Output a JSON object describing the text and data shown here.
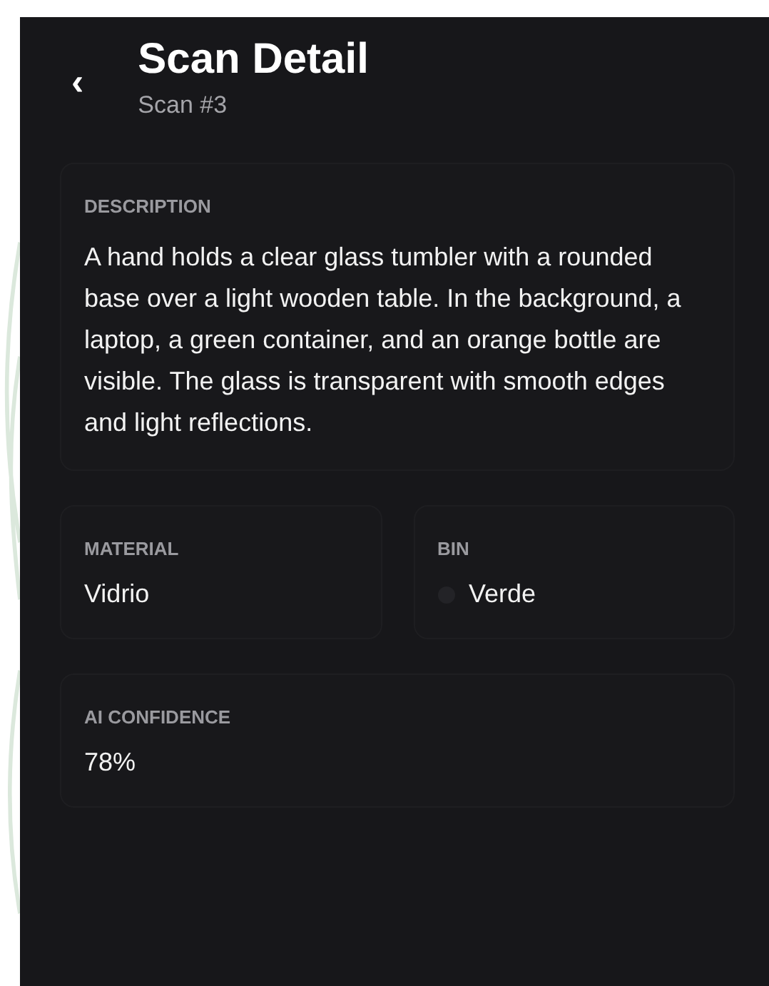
{
  "header": {
    "back": "‹",
    "title": "Scan Detail",
    "subtitle": "Scan #3"
  },
  "description": {
    "label": "DESCRIPTION",
    "text": "A hand holds a clear glass tumbler with a rounded base over a light wooden table. In the background, a laptop, a green container, and an orange bottle are visible. The glass is transparent with smooth edges and light reflections."
  },
  "material": {
    "label": "MATERIAL",
    "value": "Vidrio"
  },
  "bin": {
    "label": "BIN",
    "value": "Verde",
    "color": "#232327"
  },
  "confidence": {
    "label": "AI CONFIDENCE",
    "value": "78%"
  }
}
